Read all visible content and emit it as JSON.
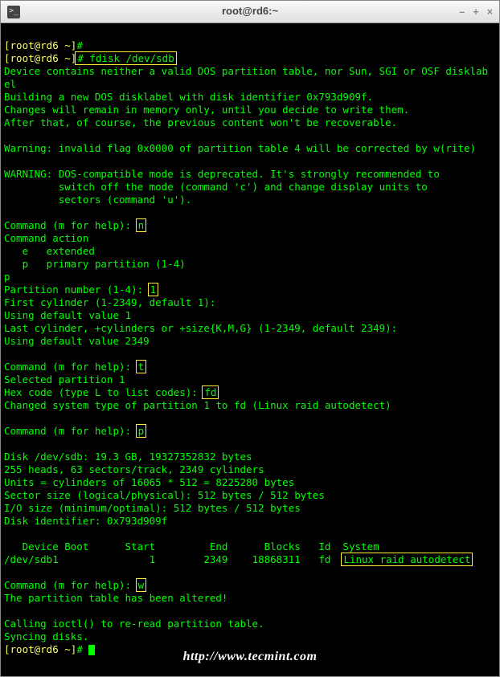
{
  "window": {
    "title": "root@rd6:~",
    "minimize": "–",
    "maximize": "+",
    "close": "×"
  },
  "prompt": {
    "p1_user": "[root@rd6 ~]",
    "p1_hash": "#",
    "cmd1": " fdisk /dev/sdb",
    "p2_user": "[root@rd6 ~]",
    "p2_hash": "#",
    "p3_user": "[root@rd6 ~]",
    "p3_hash": "# "
  },
  "out": {
    "l1": "Device contains neither a valid DOS partition table, nor Sun, SGI or OSF disklab",
    "l2": "el",
    "l3": "Building a new DOS disklabel with disk identifier 0x793d909f.",
    "l4": "Changes will remain in memory only, until you decide to write them.",
    "l5": "After that, of course, the previous content won't be recoverable.",
    "blank1": " ",
    "l6": "Warning: invalid flag 0x0000 of partition table 4 will be corrected by w(rite)",
    "blank2": " ",
    "l7": "WARNING: DOS-compatible mode is deprecated. It's strongly recommended to",
    "l8": "         switch off the mode (command 'c') and change display units to",
    "l9": "         sectors (command 'u').",
    "blank3": " ",
    "cmd_n_label": "Command (m for help): ",
    "cmd_n": "n",
    "l10": "Command action",
    "l11": "   e   extended",
    "l12": "   p   primary partition (1-4)",
    "l13": "p",
    "pnum_label": "Partition number (1-4): ",
    "pnum": "1",
    "l14": "First cylinder (1-2349, default 1):",
    "l15": "Using default value 1",
    "l16": "Last cylinder, +cylinders or +size{K,M,G} (1-2349, default 2349):",
    "l17": "Using default value 2349",
    "blank4": " ",
    "cmd_t_label": "Command (m for help): ",
    "cmd_t": "t",
    "l18": "Selected partition 1",
    "hex_label": "Hex code (type L to list codes): ",
    "hex": "fd",
    "l19": "Changed system type of partition 1 to fd (Linux raid autodetect)",
    "blank5": " ",
    "cmd_p_label": "Command (m for help): ",
    "cmd_p": "p",
    "blank6": " ",
    "l20": "Disk /dev/sdb: 19.3 GB, 19327352832 bytes",
    "l21": "255 heads, 63 sectors/track, 2349 cylinders",
    "l22": "Units = cylinders of 16065 * 512 = 8225280 bytes",
    "l23": "Sector size (logical/physical): 512 bytes / 512 bytes",
    "l24": "I/O size (minimum/optimal): 512 bytes / 512 bytes",
    "l25": "Disk identifier: 0x793d909f",
    "blank7": " ",
    "th": "   Device Boot      Start         End      Blocks   Id  System",
    "tr_a": "/dev/sdb1               1        2349    18868311   fd  ",
    "tr_b": "Linux raid autodetect",
    "blank8": " ",
    "cmd_w_label": "Command (m for help): ",
    "cmd_w": "w",
    "l26": "The partition table has been altered!",
    "blank9": " ",
    "l27": "Calling ioctl() to re-read partition table.",
    "l28": "Syncing disks."
  },
  "watermark": "http://www.tecmint.com"
}
